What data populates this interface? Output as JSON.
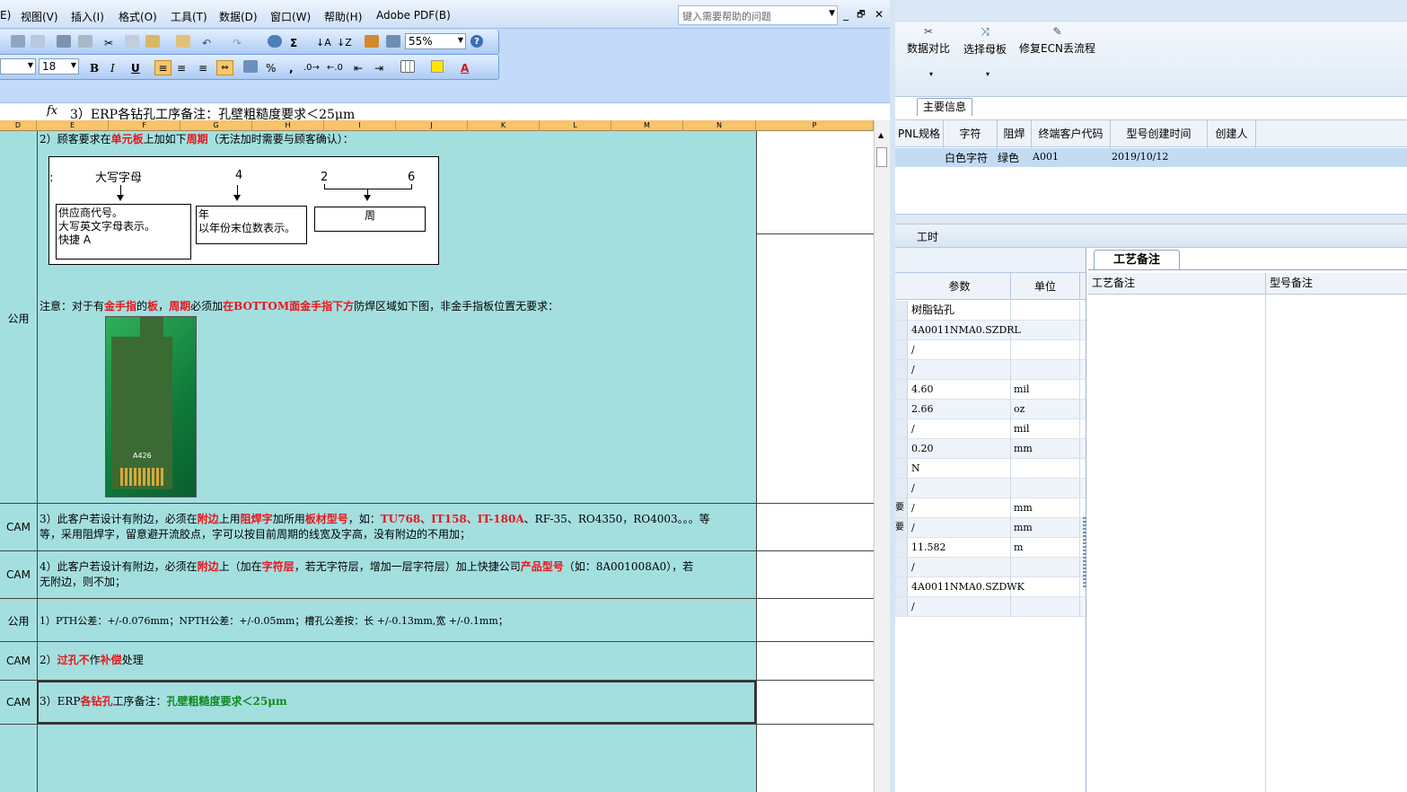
{
  "excel": {
    "menu": [
      "E)",
      "视图(V)",
      "插入(I)",
      "格式(O)",
      "工具(T)",
      "数据(D)",
      "窗口(W)",
      "帮助(H)",
      "Adobe PDF(B)"
    ],
    "help_placeholder": "键入需要帮助的问题",
    "window_controls": [
      "_",
      "🗗",
      "✕"
    ],
    "zoom": "55%",
    "font_size": "18",
    "toolbar_symbols": {
      "sigma": "Σ",
      "bold": "B",
      "italic": "I",
      "underline": "U",
      "percent": "%",
      "comma": ",",
      "font_color": "A",
      "help": "?"
    },
    "formula_fx": "fx",
    "formula_text": "3）ERP各钻孔工序备注：孔壁粗糙度要求＜25μm",
    "columns": [
      "D",
      "E",
      "F",
      "G",
      "H",
      "I",
      "J",
      "K",
      "L",
      "M",
      "N",
      "P"
    ],
    "rows": {
      "r1_label": "公用",
      "r1_line1": [
        "2）顾客要求在",
        "单元板",
        "上加如下",
        "周期",
        "（无法加时需要与顾客确认）："
      ],
      "diagram": {
        "colon": ":",
        "label_letter": "大写字母",
        "label_4": "4",
        "label_2": "2",
        "label_6": "6",
        "box1_l1": "供应商代号。",
        "box1_l2": "大写英文字母表示。",
        "box1_l3": "快捷 A",
        "box2_l1": "年",
        "box2_l2": "以年份末位数表示。",
        "box3": "周"
      },
      "r1_note": [
        "注意：对于有",
        "金手指",
        "的",
        "板",
        "，",
        "周期",
        "必须加",
        "在BOTTOM面金手指下方",
        "防焊区域如下图，非金手指板位置无要求："
      ],
      "pcb_label": "A426",
      "r2_label": "CAM",
      "r2_line1": [
        "3）此客户若设计有附边，必须在",
        "附边",
        "上用",
        "阻焊字",
        "加所用",
        "板材型号",
        "，如：",
        "TU768、IT158、IT-180A",
        "、RF-35、RO4350，RO4003。。。等"
      ],
      "r2_line2": "等，采用阻焊字，留意避开流胶点，字可以按目前周期的线宽及字高，没有附边的不用加；",
      "r3_label": "CAM",
      "r3_line1": [
        "4）此客户若设计有附边，必须在",
        "附边",
        "上（加在",
        "字符层",
        "，若无字符层，增加一层字符层）加上快捷公司",
        "产品型号",
        "（如：8A001008A0），若"
      ],
      "r3_line2": "无附边，则不加；",
      "r4_label": "公用",
      "r4_text": "1）PTH公差：+/-0.076mm；NPTH公差：+/-0.05mm；槽孔公差按：长 +/-0.13mm,宽 +/-0.1mm；",
      "r5_label": "CAM",
      "r5_line": [
        "2）",
        "过孔不",
        "作",
        "补偿",
        "处理"
      ],
      "r6_label": "CAM",
      "r6_line": [
        "3）ERP",
        "各钻孔",
        "工序备注：",
        "孔壁粗糙度要求＜25μm"
      ]
    }
  },
  "erp": {
    "ribbon": [
      {
        "label": "数据对比",
        "icon": "✂"
      },
      {
        "label": "选择母板",
        "icon": "⤨"
      },
      {
        "label": "修复ECN丢流程",
        "icon": "✎"
      }
    ],
    "dropdown_glyph": "▾",
    "main_info_tab": "主要信息",
    "grid1": {
      "headers": [
        "PNL规格",
        "字符",
        "阻焊",
        "终端客户代码",
        "型号创建时间",
        "创建人"
      ],
      "row": [
        "白色字符",
        "绿色",
        "A001",
        "2019/10/12"
      ]
    },
    "worktime": "工时",
    "grid2": {
      "headers": [
        "参数",
        "单位"
      ],
      "rows": [
        [
          "树脂钻孔",
          ""
        ],
        [
          "4A0011NMA0.SZDRL",
          ""
        ],
        [
          "/",
          ""
        ],
        [
          "/",
          ""
        ],
        [
          "4.60",
          "mil"
        ],
        [
          "2.66",
          "oz"
        ],
        [
          "/",
          "mil"
        ],
        [
          "0.20",
          "mm"
        ],
        [
          "N",
          ""
        ],
        [
          "/",
          ""
        ],
        [
          "/",
          "mm"
        ],
        [
          "/",
          "mm"
        ],
        [
          "11.582",
          "m"
        ],
        [
          "/",
          ""
        ],
        [
          "4A0011NMA0.SZDWK",
          ""
        ],
        [
          "/",
          ""
        ]
      ],
      "edge_chars": [
        "要",
        "要"
      ]
    },
    "craft_tab": "工艺备注",
    "grid3_headers": [
      "工艺备注",
      "型号备注"
    ]
  }
}
